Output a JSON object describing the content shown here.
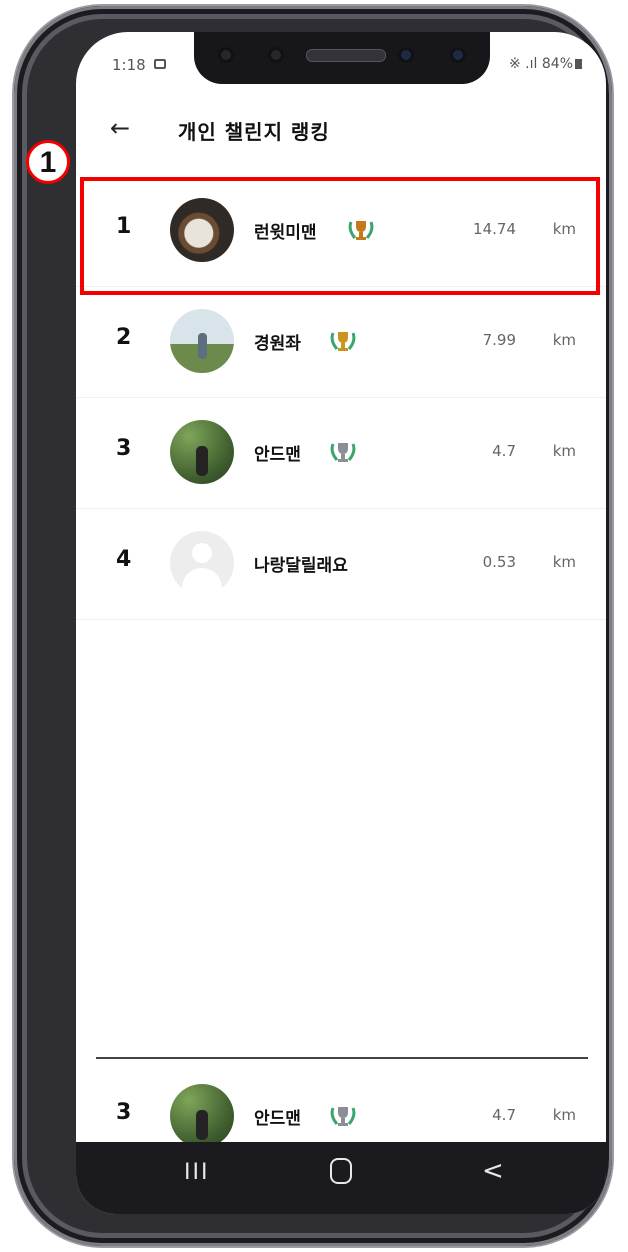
{
  "status_bar": {
    "time": "1:18",
    "signal": "※ .ıl",
    "battery": "84%"
  },
  "header": {
    "back_glyph": "←",
    "title": "개인 챌린지 랭킹"
  },
  "annotation": {
    "marker_label": "1"
  },
  "ranking": [
    {
      "rank": "1",
      "name": "런윗미맨",
      "distance": "14.74",
      "unit": "km",
      "trophy": "gold",
      "avatar": "food-photo"
    },
    {
      "rank": "2",
      "name": "경원좌",
      "distance": "7.99",
      "unit": "km",
      "trophy": "gold",
      "avatar": "field-photo"
    },
    {
      "rank": "3",
      "name": "안드맨",
      "distance": "4.7",
      "unit": "km",
      "trophy": "silver",
      "avatar": "garden-photo"
    },
    {
      "rank": "4",
      "name": "나랑달릴래요",
      "distance": "0.53",
      "unit": "km",
      "trophy": "",
      "avatar": "default-profile"
    }
  ],
  "my_rank": {
    "rank": "3",
    "name": "안드맨",
    "distance": "4.7",
    "unit": "km",
    "trophy": "silver"
  },
  "nav": {
    "recent_glyph": "III",
    "back_glyph": "<"
  },
  "colors": {
    "highlight": "#f50000",
    "laurel": "#3aa66b",
    "trophy_gold": "#c47a1c",
    "trophy_silver": "#8a8f96"
  }
}
